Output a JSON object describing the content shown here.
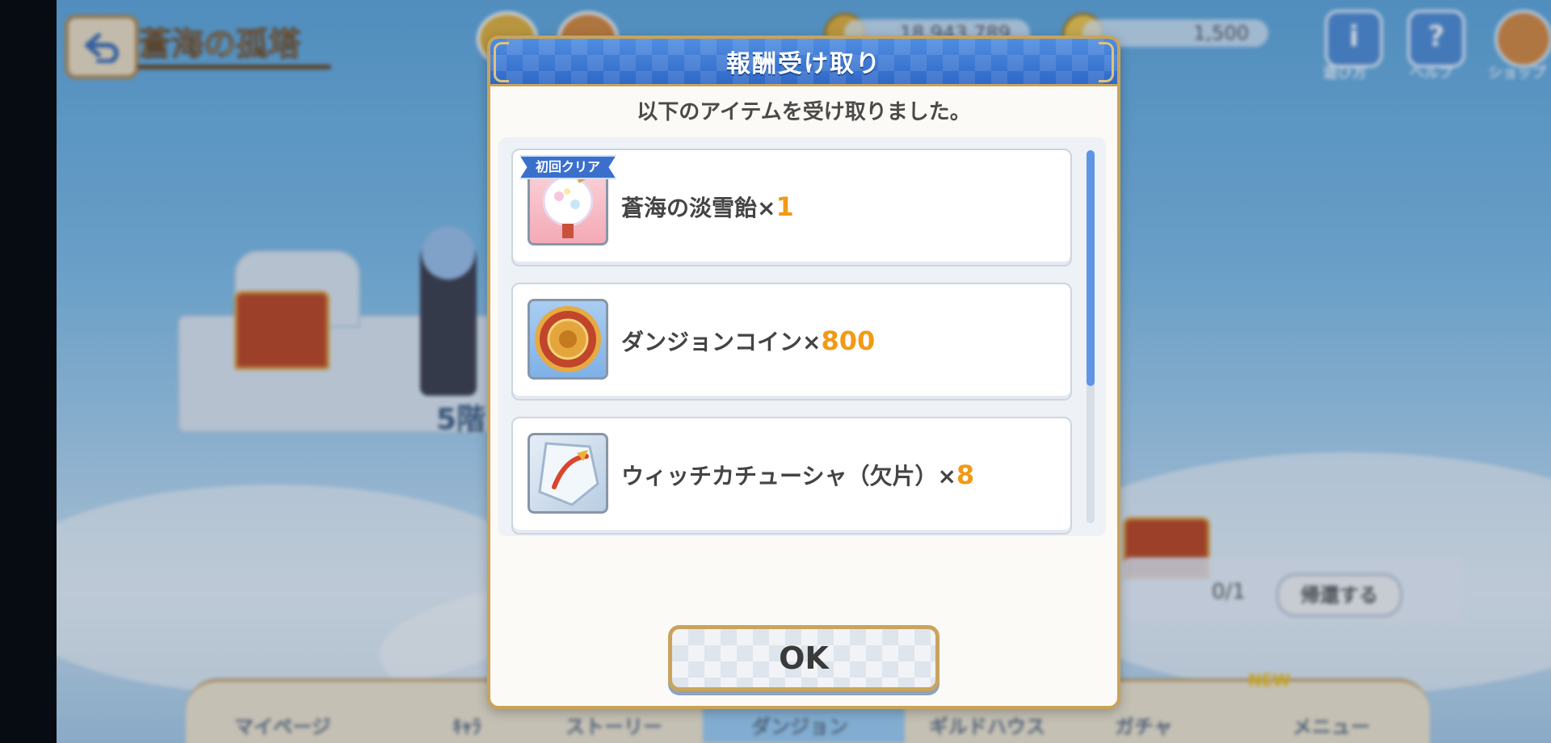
{
  "background": {
    "area_title": "蒼海の孤塔",
    "currency_gold": "18,943,789",
    "currency_gems": "1,500",
    "hud": [
      {
        "glyph": "i",
        "label": "遊び方"
      },
      {
        "glyph": "?",
        "label": "ヘルプ"
      },
      {
        "glyph": "",
        "label": "ショップ"
      }
    ],
    "floor_label": "5階",
    "return_count": "0/1",
    "return_button": "帰還する",
    "nav": [
      {
        "label": "マイページ"
      },
      {
        "label": "ｷｬﾗ"
      },
      {
        "label": "ストーリー"
      },
      {
        "label": "ダンジョン"
      },
      {
        "label": "ギルドハウス"
      },
      {
        "label": "ガチャ"
      },
      {
        "label": "メニュー"
      }
    ],
    "nav_new_badge": "NEW"
  },
  "dialog": {
    "title": "報酬受け取り",
    "message": "以下のアイテムを受け取りました。",
    "rewards": [
      {
        "name": "蒼海の淡雪飴×",
        "quantity": "1",
        "badge": "初回クリア",
        "icon": "snow-candy-icon"
      },
      {
        "name": "ダンジョンコイン×",
        "quantity": "800",
        "icon": "dungeon-coin-icon"
      },
      {
        "name": "ウィッチカチューシャ（欠片）×",
        "quantity": "8",
        "icon": "witch-headband-fragment-icon"
      }
    ],
    "ok_label": "OK",
    "colors": {
      "header": "#2f68c7",
      "border_gold": "#c9a35b",
      "quantity": "#f19a15"
    }
  }
}
